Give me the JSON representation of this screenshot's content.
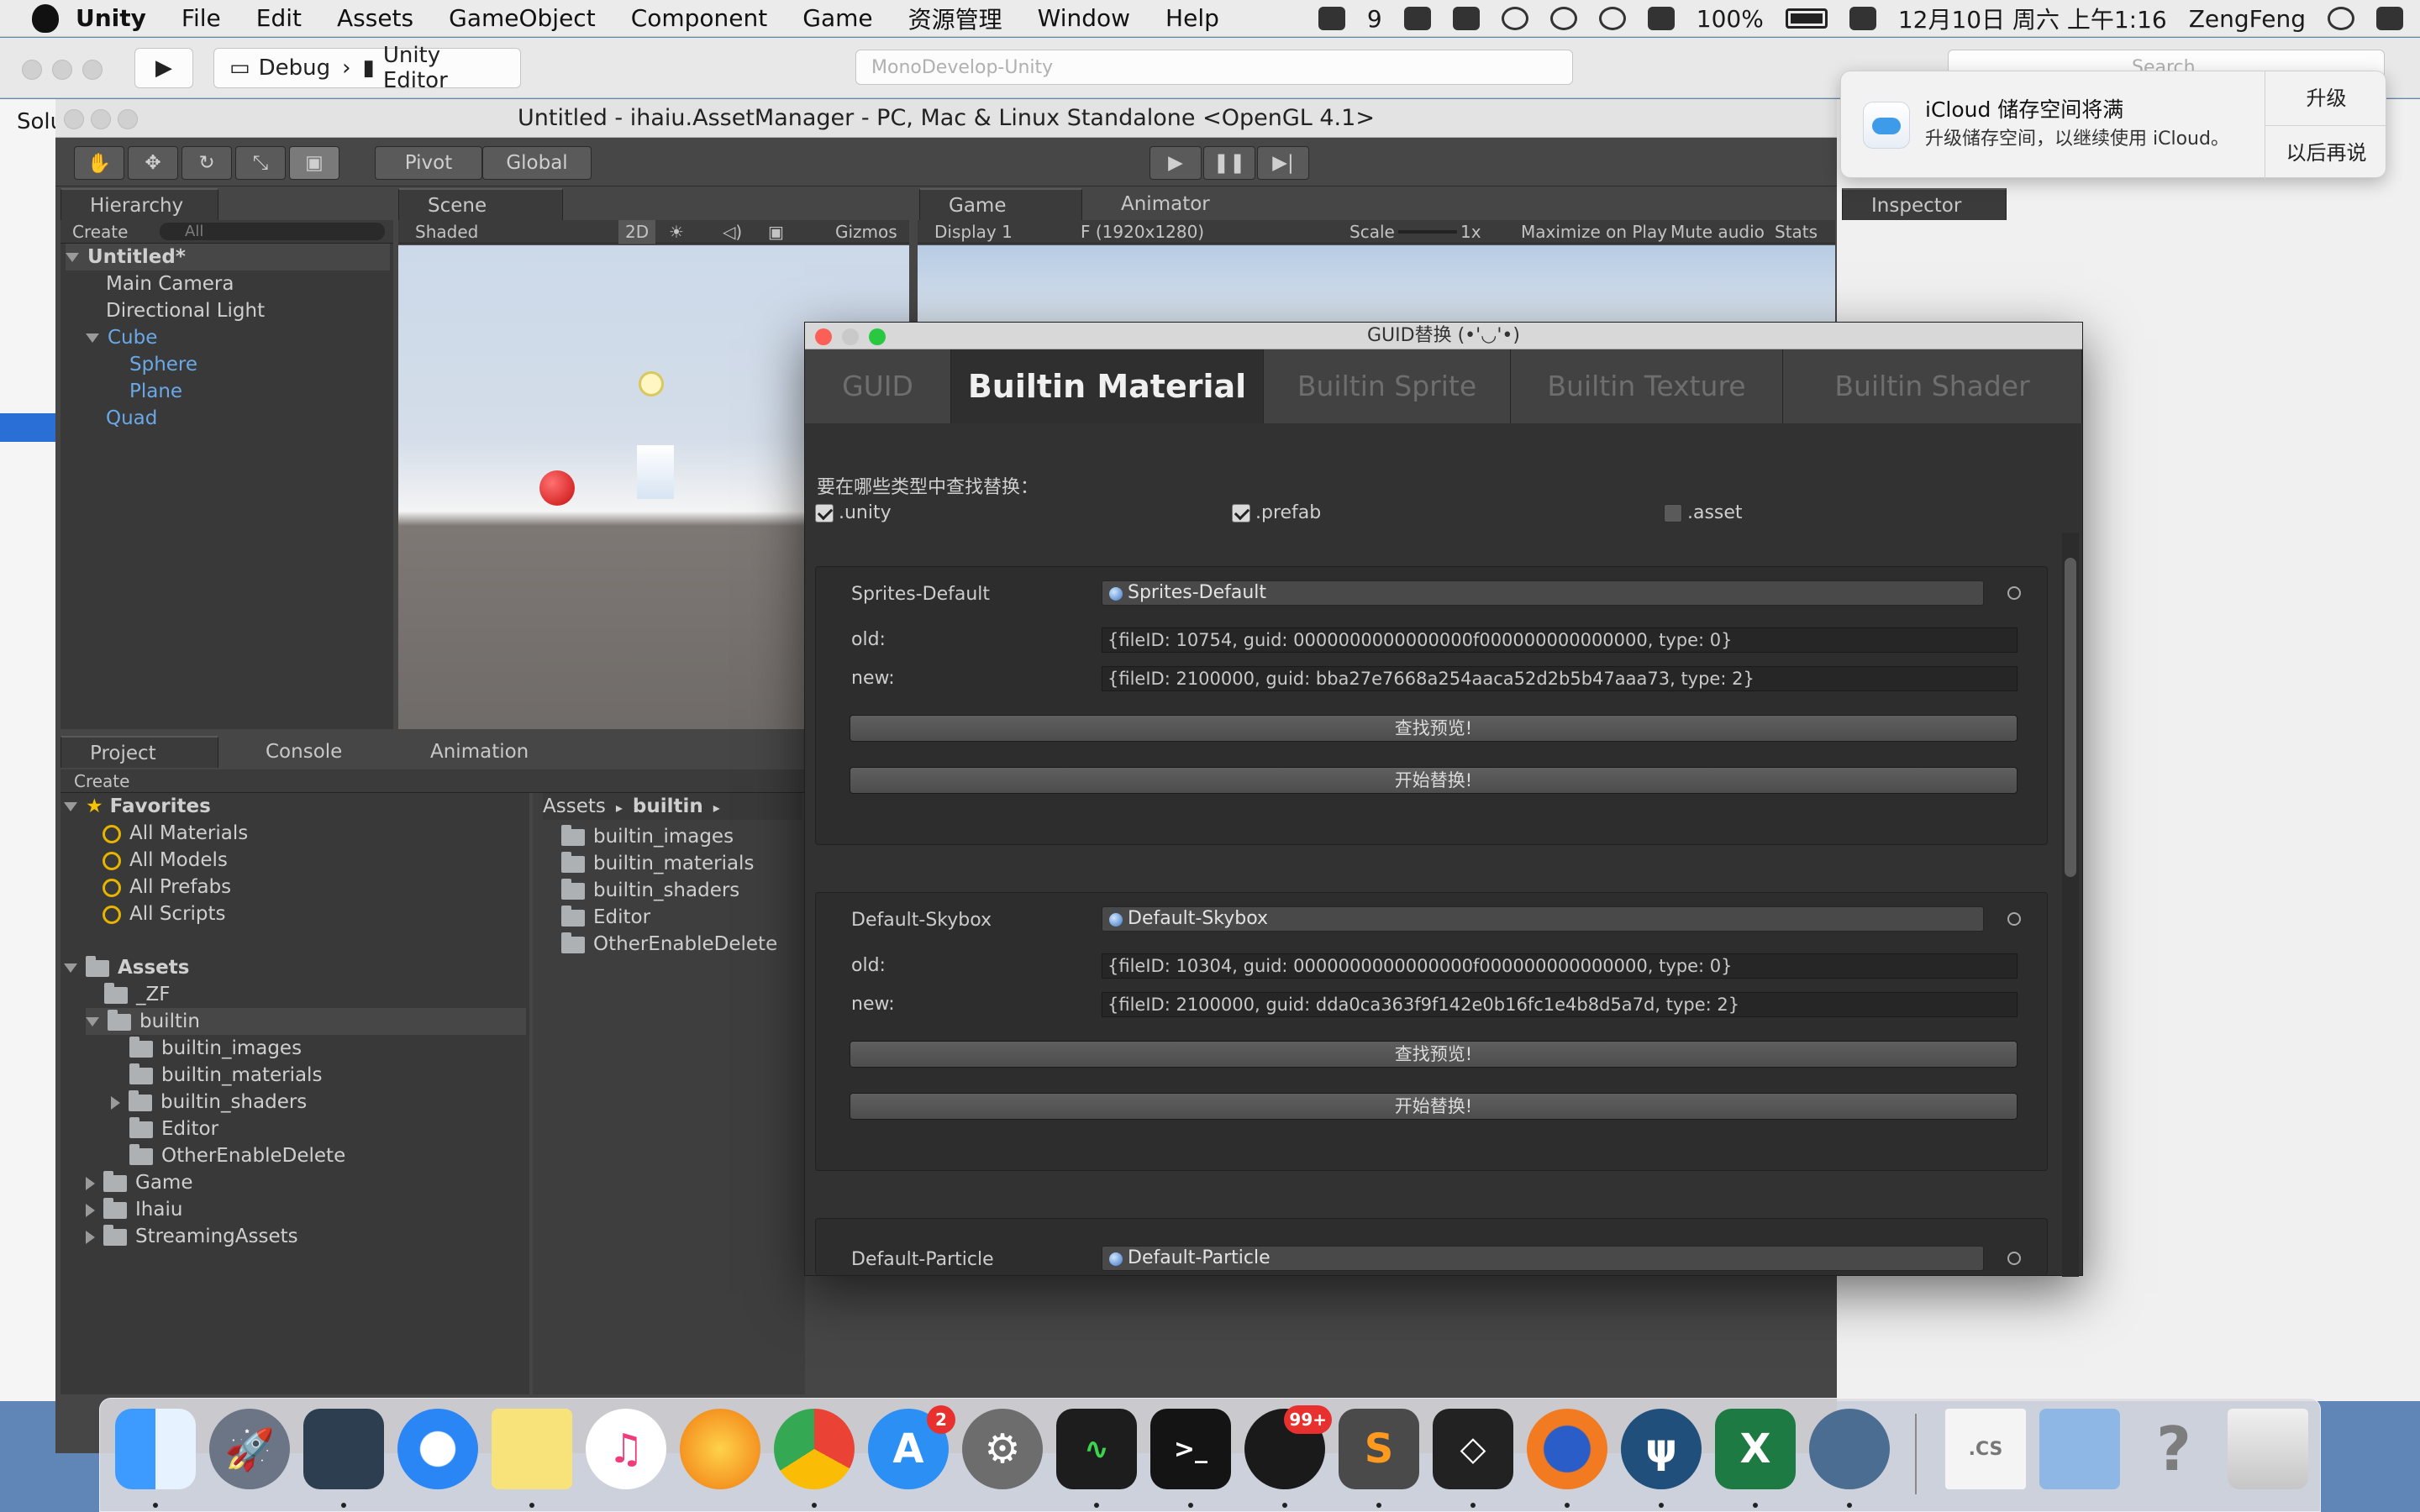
{
  "menubar": {
    "app": "Unity",
    "items": [
      "File",
      "Edit",
      "Assets",
      "GameObject",
      "Component",
      "Game",
      "资源管理",
      "Window",
      "Help"
    ],
    "qq_count": "9",
    "battery": "100%",
    "datetime": "12月10日 周六 上午1:16",
    "user": "ZengFeng"
  },
  "toolbar": {
    "scheme": "Debug",
    "target": "Unity Editor",
    "address": "MonoDevelop-Unity",
    "search_placeholder": "Search"
  },
  "left_partial": "Solu",
  "editor": {
    "title": "Untitled - ihaiu.AssetManager - PC, Mac & Linux Standalone <OpenGL 4.1>",
    "tools": {
      "pivot": "Pivot",
      "global": "Global"
    },
    "hierarchy": {
      "tab": "Hierarchy",
      "create": "Create",
      "search_placeholder": "All",
      "scene": "Untitled*",
      "items": [
        "Main Camera",
        "Directional Light",
        "Cube",
        "Sphere",
        "Plane",
        "Quad"
      ]
    },
    "scene": {
      "tab": "Scene",
      "shading": "Shaded",
      "mode2d": "2D",
      "gizmos": "Gizmos"
    },
    "game": {
      "tab": "Game",
      "animator_tab": "Animator",
      "display": "Display 1",
      "resolution": "F (1920x1280)",
      "scale_label": "Scale",
      "scale": "1x",
      "maximize": "Maximize on Play",
      "mute": "Mute audio",
      "stats": "Stats"
    },
    "inspector": {
      "tab": "Inspector"
    },
    "project": {
      "tabs": [
        "Project",
        "Console",
        "Animation"
      ],
      "create": "Create",
      "favorites": {
        "label": "Favorites",
        "items": [
          "All Materials",
          "All Models",
          "All Prefabs",
          "All Scripts"
        ]
      },
      "assets": {
        "label": "Assets",
        "items": [
          "_ZF",
          "builtin",
          "builtin_images",
          "builtin_materials",
          "builtin_shaders",
          "Editor",
          "OtherEnableDelete",
          "Game",
          "Ihaiu",
          "StreamingAssets"
        ]
      },
      "breadcrumb": {
        "root": "Assets",
        "current": "builtin"
      },
      "files": [
        "builtin_images",
        "builtin_materials",
        "builtin_shaders",
        "Editor",
        "OtherEnableDelete"
      ]
    }
  },
  "popup": {
    "title": "GUID替换 (•'◡'•)",
    "tabs": [
      "GUID",
      "Builtin Material",
      "Builtin Sprite",
      "Builtin Texture",
      "Builtin Shader"
    ],
    "search_label": "要在哪些类型中查找替换：",
    "types": [
      {
        "label": ".unity",
        "checked": true
      },
      {
        "label": ".prefab",
        "checked": true
      },
      {
        "label": ".asset",
        "checked": false
      }
    ],
    "entries": [
      {
        "name": "Sprites-Default",
        "object": "Sprites-Default",
        "old_label": "old:",
        "old": "{fileID: 10754, guid: 0000000000000000f000000000000000, type: 0}",
        "new_label": "new:",
        "new": "{fileID: 2100000, guid: bba27e7668a254aaca52d2b5b47aaa73, type: 2}",
        "preview_btn": "查找预览!",
        "replace_btn": "开始替换!"
      },
      {
        "name": "Default-Skybox",
        "object": "Default-Skybox",
        "old_label": "old:",
        "old": "{fileID: 10304, guid: 0000000000000000f000000000000000, type: 0}",
        "new_label": "new:",
        "new": "{fileID: 2100000, guid: dda0ca363f9f142e0b16fc1e4b8d5a7d, type: 2}",
        "preview_btn": "查找预览!",
        "replace_btn": "开始替换!"
      },
      {
        "name": "Default-Particle",
        "object": "Default-Particle"
      }
    ]
  },
  "notification": {
    "title": "iCloud 储存空间将满",
    "body": "升级储存空间，以继续使用 iCloud。",
    "action": "升级",
    "later": "以后再说"
  },
  "dock": {
    "appstore_badge": "2",
    "qq_badge": "99+"
  },
  "colors": {
    "accent": "#6aa8e6",
    "dark_panel": "#393939",
    "popup_bg": "#323232"
  }
}
